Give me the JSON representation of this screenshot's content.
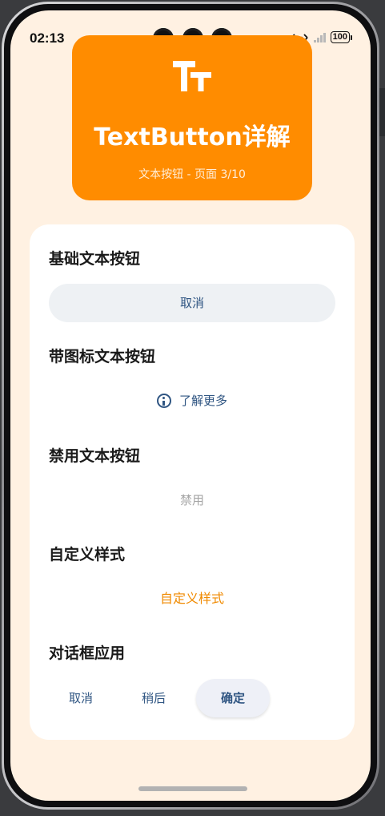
{
  "status_bar": {
    "time": "02:13",
    "battery": "100"
  },
  "header": {
    "title": "TextButton详解",
    "subtitle": "文本按钮 - 页面 3/10",
    "background_color": "#ff8c00"
  },
  "sections": {
    "basic": {
      "title": "基础文本按钮",
      "button_label": "取消"
    },
    "with_icon": {
      "title": "带图标文本按钮",
      "button_label": "了解更多",
      "icon": "info-icon"
    },
    "disabled": {
      "title": "禁用文本按钮",
      "button_label": "禁用"
    },
    "custom": {
      "title": "自定义样式",
      "button_label": "自定义样式",
      "accent_color": "#f08a00"
    },
    "dialog": {
      "title": "对话框应用",
      "buttons": [
        "取消",
        "稍后",
        "确定"
      ]
    }
  },
  "colors": {
    "screen_background": "#fff1e2",
    "button_text": "#2f5582",
    "disabled_text": "#a4a4a4"
  }
}
